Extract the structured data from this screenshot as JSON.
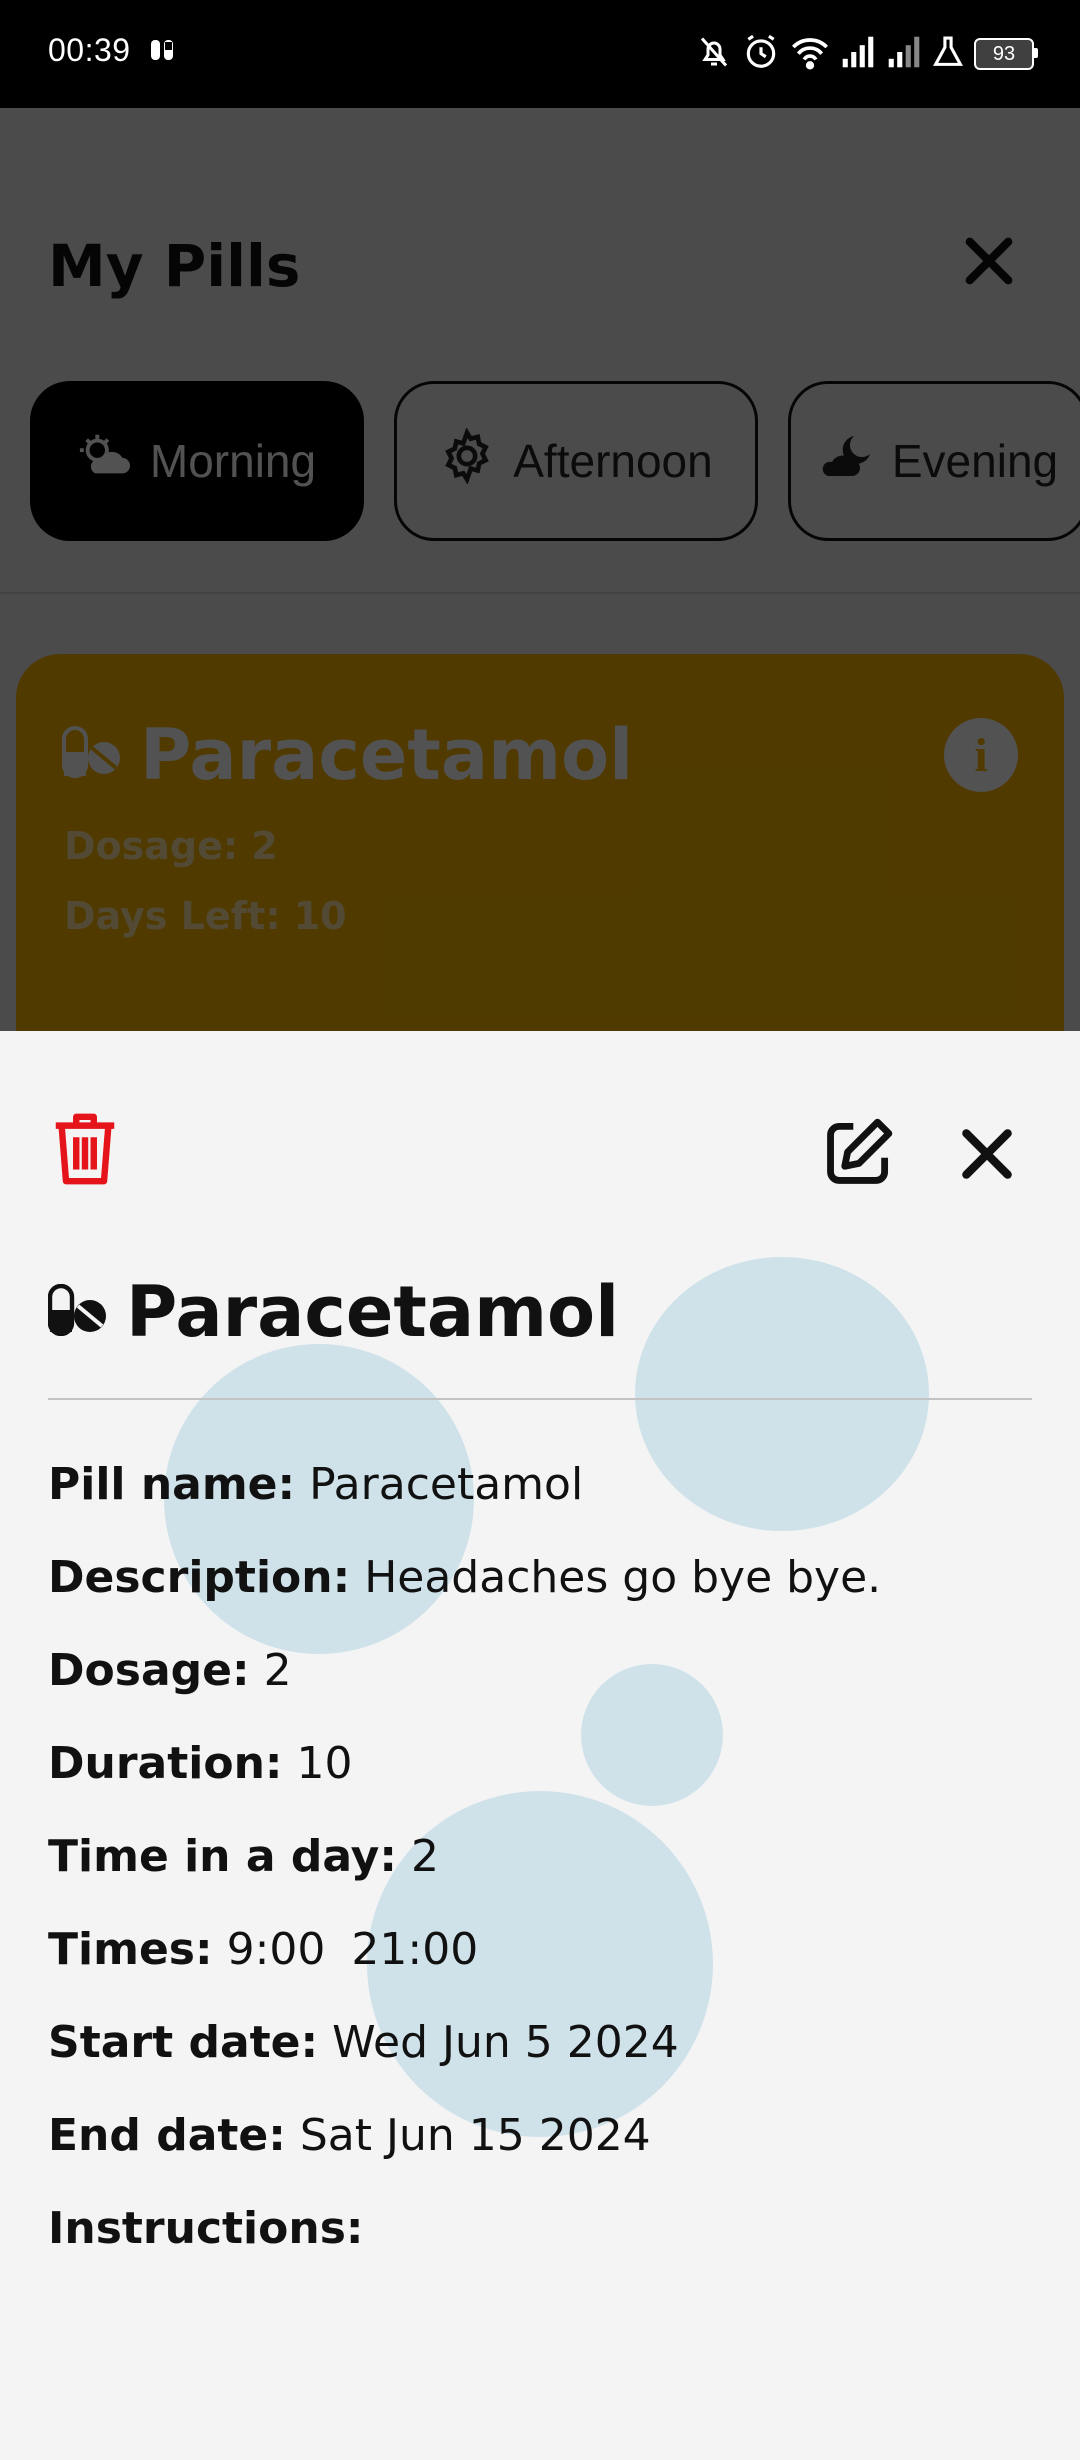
{
  "status_bar": {
    "time": "00:39",
    "battery": "93",
    "icons": [
      "sim-icon",
      "mute-icon",
      "alarm-icon",
      "wifi-icon",
      "signal-icon",
      "signal-icon",
      "lab-icon",
      "battery-icon"
    ]
  },
  "background_screen": {
    "title": "My Pills",
    "tabs": [
      {
        "label": "Morning",
        "icon": "sun-cloud-icon",
        "active": true
      },
      {
        "label": "Afternoon",
        "icon": "gear-icon",
        "active": false
      },
      {
        "label": "Evening",
        "icon": "moon-cloud-icon",
        "active": false
      }
    ],
    "card": {
      "name": "Paracetamol",
      "dosage_label": "Dosage: 2",
      "days_left_label": "Days Left: 10",
      "color": "#f7b500"
    }
  },
  "sheet": {
    "title": "Paracetamol",
    "details": {
      "pill_name": {
        "key": "Pill name:",
        "value": "Paracetamol"
      },
      "description": {
        "key": "Description:",
        "value": "Headaches go bye bye."
      },
      "dosage": {
        "key": "Dosage:",
        "value": "2"
      },
      "duration": {
        "key": "Duration:",
        "value": "10"
      },
      "times_in_day": {
        "key": "Time in a day:",
        "value": "2"
      },
      "times": {
        "key": "Times:",
        "values": [
          "9:00",
          "21:00"
        ]
      },
      "start_date": {
        "key": "Start date:",
        "value": "Wed Jun 5 2024"
      },
      "end_date": {
        "key": "End date:",
        "value": "Sat Jun 15 2024"
      },
      "instructions": {
        "key": "Instructions:",
        "value": ""
      }
    },
    "colors": {
      "delete": "#e5141a",
      "accent_bubble": "#cfe2ea"
    }
  }
}
